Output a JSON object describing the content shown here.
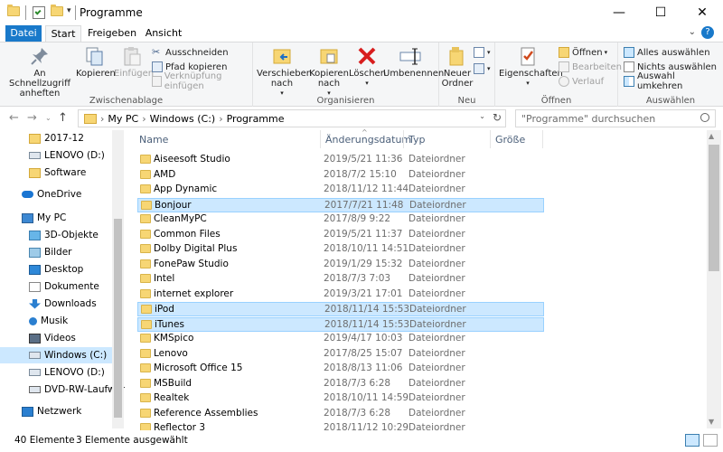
{
  "window": {
    "title": "Programme",
    "minimize": "—",
    "maximize": "☐",
    "close": "✕"
  },
  "tabs": {
    "datei": "Datei",
    "start": "Start",
    "freigeben": "Freigeben",
    "ansicht": "Ansicht",
    "help": "?"
  },
  "ribbon": {
    "zwischenablage": {
      "label": "Zwischenablage",
      "pin": "An Schnellzugriff anheften",
      "kopieren": "Kopieren",
      "einfuegen": "Einfügen",
      "ausschneiden": "Ausschneiden",
      "pfad_kopieren": "Pfad kopieren",
      "verknuepfung": "Verknüpfung einfügen"
    },
    "organisieren": {
      "label": "Organisieren",
      "verschieben": "Verschieben nach",
      "kopieren_nach": "Kopieren nach",
      "loeschen": "Löschen",
      "umbenennen": "Umbenennen"
    },
    "neu": {
      "label": "Neu",
      "neuer_ordner": "Neuer Ordner"
    },
    "oeffnen": {
      "label": "Öffnen",
      "eigenschaften": "Eigenschaften",
      "oeffnen": "Öffnen",
      "bearbeiten": "Bearbeiten",
      "verlauf": "Verlauf"
    },
    "auswaehlen": {
      "label": "Auswählen",
      "alles": "Alles auswählen",
      "nichts": "Nichts auswählen",
      "umkehren": "Auswahl umkehren"
    }
  },
  "address": {
    "path_1": "My PC",
    "path_2": "Windows (C:)",
    "path_3": "Programme",
    "search_placeholder": "\"Programme\" durchsuchen"
  },
  "nav": [
    {
      "label": "2017-12",
      "icon": "folder",
      "indent": 2
    },
    {
      "label": "LENOVO (D:)",
      "icon": "drive",
      "indent": 2
    },
    {
      "label": "Software",
      "icon": "folder",
      "indent": 2
    },
    {
      "label": "OneDrive",
      "icon": "cloud",
      "indent": 1
    },
    {
      "label": "My PC",
      "icon": "pc",
      "indent": 1
    },
    {
      "label": "3D-Objekte",
      "icon": "cube",
      "indent": 2
    },
    {
      "label": "Bilder",
      "icon": "pictures",
      "indent": 2
    },
    {
      "label": "Desktop",
      "icon": "desktop",
      "indent": 2
    },
    {
      "label": "Dokumente",
      "icon": "documents",
      "indent": 2
    },
    {
      "label": "Downloads",
      "icon": "download",
      "indent": 2
    },
    {
      "label": "Musik",
      "icon": "music",
      "indent": 2
    },
    {
      "label": "Videos",
      "icon": "videos",
      "indent": 2
    },
    {
      "label": "Windows (C:)",
      "icon": "drive",
      "indent": 2,
      "selected": true
    },
    {
      "label": "LENOVO (D:)",
      "icon": "drive",
      "indent": 2
    },
    {
      "label": "DVD-RW-Laufwerk",
      "icon": "dvd",
      "indent": 2
    },
    {
      "label": "Netzwerk",
      "icon": "network",
      "indent": 1
    }
  ],
  "columns": {
    "name": "Name",
    "date": "Änderungsdatum",
    "type": "Typ",
    "size": "Größe"
  },
  "files": [
    {
      "name": "Aiseesoft Studio",
      "date": "2019/5/21 11:36",
      "type": "Dateiordner"
    },
    {
      "name": "AMD",
      "date": "2018/7/2 15:10",
      "type": "Dateiordner"
    },
    {
      "name": "App Dynamic",
      "date": "2018/11/12 11:44",
      "type": "Dateiordner"
    },
    {
      "name": "Bonjour",
      "date": "2017/7/21 11:48",
      "type": "Dateiordner",
      "selected": true
    },
    {
      "name": "CleanMyPC",
      "date": "2017/8/9 9:22",
      "type": "Dateiordner"
    },
    {
      "name": "Common Files",
      "date": "2019/5/21 11:37",
      "type": "Dateiordner"
    },
    {
      "name": "Dolby Digital Plus",
      "date": "2018/10/11 14:51",
      "type": "Dateiordner"
    },
    {
      "name": "FonePaw Studio",
      "date": "2019/1/29 15:32",
      "type": "Dateiordner"
    },
    {
      "name": "Intel",
      "date": "2018/7/3 7:03",
      "type": "Dateiordner"
    },
    {
      "name": "internet explorer",
      "date": "2019/3/21 17:01",
      "type": "Dateiordner"
    },
    {
      "name": "iPod",
      "date": "2018/11/14 15:53",
      "type": "Dateiordner",
      "selected": true
    },
    {
      "name": "iTunes",
      "date": "2018/11/14 15:53",
      "type": "Dateiordner",
      "selected": true
    },
    {
      "name": "KMSpico",
      "date": "2019/4/17 10:03",
      "type": "Dateiordner"
    },
    {
      "name": "Lenovo",
      "date": "2017/8/25 15:07",
      "type": "Dateiordner"
    },
    {
      "name": "Microsoft Office 15",
      "date": "2018/8/13 11:06",
      "type": "Dateiordner"
    },
    {
      "name": "MSBuild",
      "date": "2018/7/3 6:28",
      "type": "Dateiordner"
    },
    {
      "name": "Realtek",
      "date": "2018/10/11 14:59",
      "type": "Dateiordner"
    },
    {
      "name": "Reference Assemblies",
      "date": "2018/7/3 6:28",
      "type": "Dateiordner"
    },
    {
      "name": "Reflector 3",
      "date": "2018/11/12 10:29",
      "type": "Dateiordner"
    }
  ],
  "status": {
    "count": "40 Elemente",
    "selected": "3 Elemente ausgewählt"
  }
}
